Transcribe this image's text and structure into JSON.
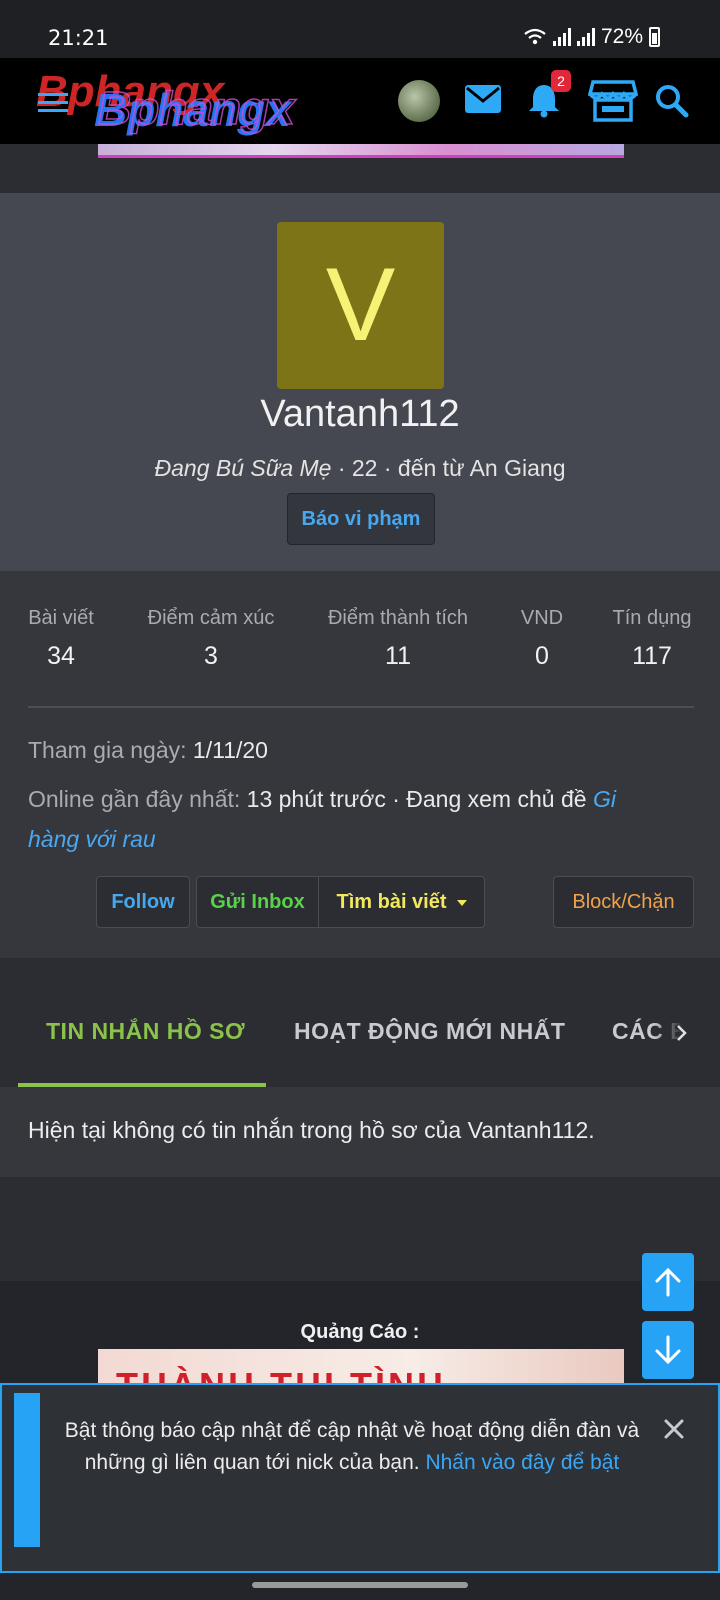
{
  "status_bar": {
    "time": "21:21",
    "battery": "72%"
  },
  "header": {
    "logo_text": "Bphangx",
    "notification_count": "2"
  },
  "profile": {
    "avatar_letter": "V",
    "username": "Vantanh112",
    "user_title": "Đang Bú Sữa Mẹ",
    "age_location": " · 22 · đến từ An Giang",
    "report_label": "Báo vi phạm"
  },
  "stats": [
    {
      "label": "Bài viết",
      "value": "34"
    },
    {
      "label": "Điểm cảm xúc",
      "value": "3"
    },
    {
      "label": "Điểm thành tích",
      "value": "11"
    },
    {
      "label": "VND",
      "value": "0"
    },
    {
      "label": "Tín dụng",
      "value": "117"
    }
  ],
  "info": {
    "joined_label": "Tham gia ngày:",
    "joined_value": "1/11/20",
    "online_label": "Online gần đây nhất:",
    "online_value": "13 phút trước · Đang xem chủ đề",
    "online_thread_line1": "Gi",
    "online_thread_line2": "hàng với rau"
  },
  "actions": {
    "follow": "Follow",
    "inbox": "Gửi Inbox",
    "find_posts": "Tìm bài viết",
    "block": "Block/Chặn"
  },
  "tabs": [
    {
      "label": "TIN NHẮN HỒ SƠ",
      "active": true
    },
    {
      "label": "HOẠT ĐỘNG MỚI NHẤT",
      "active": false
    },
    {
      "label": "CÁC B",
      "active": false
    }
  ],
  "empty_message": "Hiện tại không có tin nhắn trong hồ sơ của Vantanh112.",
  "ads": {
    "label": "Quảng Cáo :",
    "banner_text": "THÀNH THI TÌNH"
  },
  "notification": {
    "text": "Bật thông báo cập nhật để cập nhật về hoạt động diễn đàn và những gì liên quan tới nick của bạn.",
    "link": "Nhấn vào đây để bật"
  },
  "colors": {
    "accent_blue": "#27a3f5",
    "active_tab_green": "#8bc34a",
    "inbox_green": "#5ad14a",
    "find_yellow": "#f2e85b",
    "block_orange": "#f0a24a",
    "avatar_bg": "#7d7417"
  },
  "icons": [
    "menu-icon",
    "mail-icon",
    "bell-icon",
    "store-icon",
    "search-icon",
    "arrow-up-icon",
    "arrow-down-icon",
    "close-icon"
  ]
}
